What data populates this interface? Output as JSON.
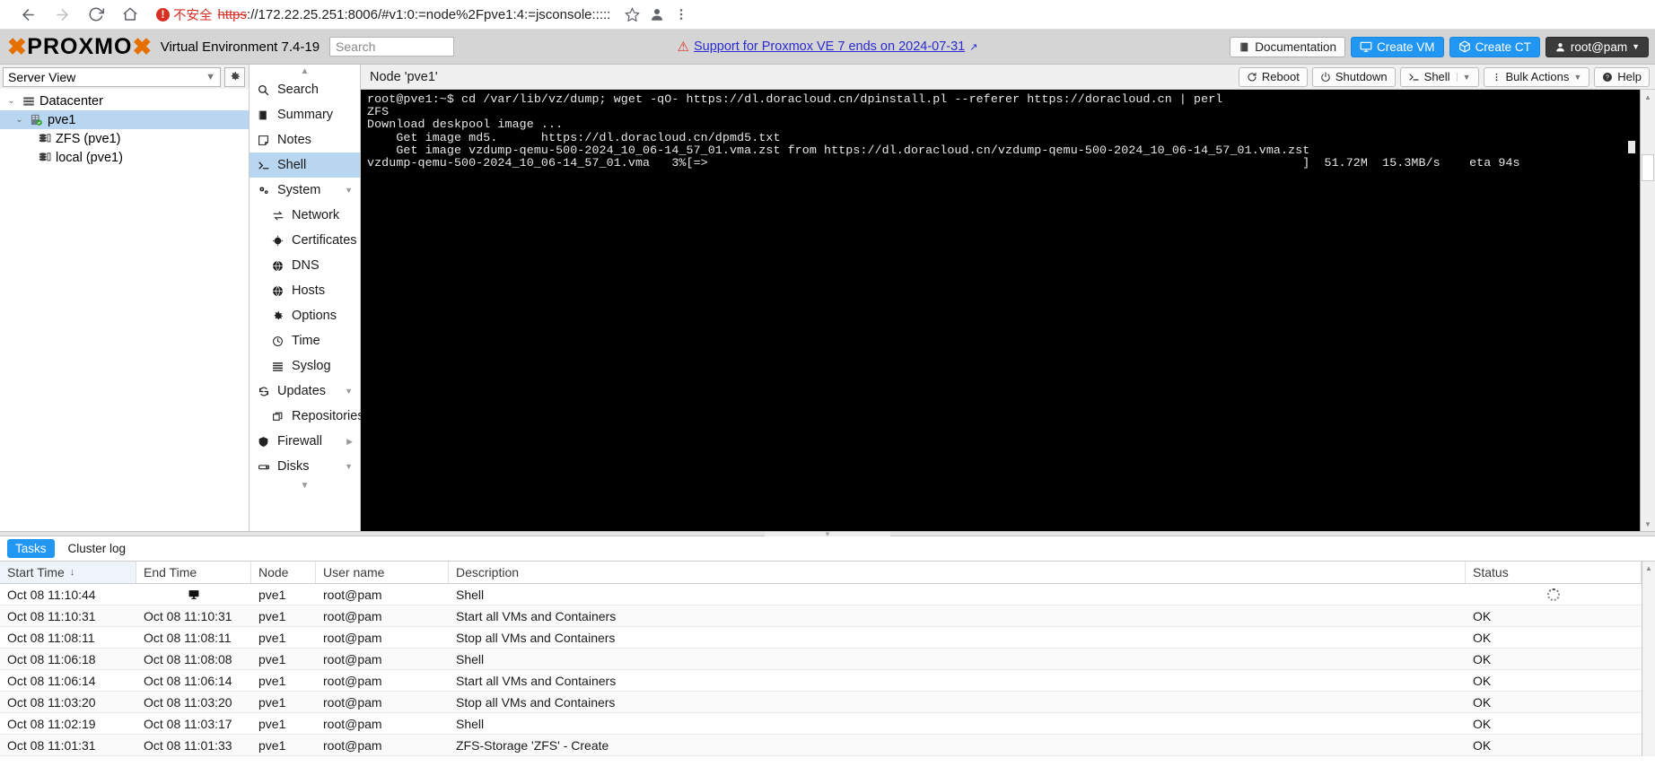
{
  "browser": {
    "back_icon": "back-arrow-icon",
    "forward_icon": "forward-arrow-icon",
    "reload_icon": "reload-icon",
    "home_icon": "home-icon",
    "security_label": "不安全",
    "url_scheme": "https",
    "url_rest": "://172.22.25.251:8006/#v1:0:=node%2Fpve1:4:=jsconsole:::::",
    "bookmark_icon": "star-icon",
    "profile_icon": "profile-icon",
    "menu_icon": "more-menu-icon"
  },
  "header": {
    "logo_word1": "PROXMO",
    "product": "Virtual Environment 7.4-19",
    "search_placeholder": "Search",
    "support_text": "Support for Proxmox VE 7 ends on 2024-07-31",
    "buttons": {
      "documentation": "Documentation",
      "create_vm": "Create VM",
      "create_ct": "Create CT",
      "user": "root@pam"
    }
  },
  "sidebar": {
    "view_label": "Server View",
    "gear_icon": "gear-icon",
    "tree": [
      {
        "label": "Datacenter",
        "icon": "datacenter-icon",
        "level": 0,
        "selected": false,
        "expander": "⌄"
      },
      {
        "label": "pve1",
        "icon": "node-icon",
        "level": 1,
        "selected": true,
        "expander": "⌄"
      },
      {
        "label": "ZFS (pve1)",
        "icon": "storage-icon",
        "level": 2,
        "selected": false,
        "expander": ""
      },
      {
        "label": "local (pve1)",
        "icon": "storage-icon",
        "level": 2,
        "selected": false,
        "expander": ""
      }
    ]
  },
  "nav": {
    "items": [
      {
        "label": "Search",
        "icon": "search-icon",
        "sub": false,
        "active": false,
        "arrow": ""
      },
      {
        "label": "Summary",
        "icon": "book-icon",
        "sub": false,
        "active": false,
        "arrow": ""
      },
      {
        "label": "Notes",
        "icon": "note-icon",
        "sub": false,
        "active": false,
        "arrow": ""
      },
      {
        "label": "Shell",
        "icon": "terminal-icon",
        "sub": false,
        "active": true,
        "arrow": ""
      },
      {
        "label": "System",
        "icon": "system-gears-icon",
        "sub": false,
        "active": false,
        "arrow": "▼"
      },
      {
        "label": "Network",
        "icon": "network-icon",
        "sub": true,
        "active": false,
        "arrow": ""
      },
      {
        "label": "Certificates",
        "icon": "certificate-icon",
        "sub": true,
        "active": false,
        "arrow": ""
      },
      {
        "label": "DNS",
        "icon": "globe-icon",
        "sub": true,
        "active": false,
        "arrow": ""
      },
      {
        "label": "Hosts",
        "icon": "globe-icon",
        "sub": true,
        "active": false,
        "arrow": ""
      },
      {
        "label": "Options",
        "icon": "gear-icon",
        "sub": true,
        "active": false,
        "arrow": ""
      },
      {
        "label": "Time",
        "icon": "clock-icon",
        "sub": true,
        "active": false,
        "arrow": ""
      },
      {
        "label": "Syslog",
        "icon": "list-icon",
        "sub": true,
        "active": false,
        "arrow": ""
      },
      {
        "label": "Updates",
        "icon": "refresh-icon",
        "sub": false,
        "active": false,
        "arrow": "▼"
      },
      {
        "label": "Repositories",
        "icon": "repository-icon",
        "sub": true,
        "active": false,
        "arrow": ""
      },
      {
        "label": "Firewall",
        "icon": "shield-icon",
        "sub": false,
        "active": false,
        "arrow": "▶"
      },
      {
        "label": "Disks",
        "icon": "disk-icon",
        "sub": false,
        "active": false,
        "arrow": "▼"
      }
    ]
  },
  "content": {
    "node_title": "Node 'pve1'",
    "toolbar": {
      "reboot": "Reboot",
      "shutdown": "Shutdown",
      "shell": "Shell",
      "bulk_actions": "Bulk Actions",
      "help": "Help"
    },
    "terminal_lines": [
      "root@pve1:~$ cd /var/lib/vz/dump; wget -qO- https://dl.doracloud.cn/dpinstall.pl --referer https://doracloud.cn | perl",
      "ZFS",
      "Download deskpool image ...",
      "    Get image md5.      https://dl.doracloud.cn/dpmd5.txt",
      "    Get image vzdump-qemu-500-2024_10_06-14_57_01.vma.zst from https://dl.doracloud.cn/vzdump-qemu-500-2024_10_06-14_57_01.vma.zst",
      "vzdump-qemu-500-2024_10_06-14_57_01.vma   3%[=>                                                                                  ]  51.72M  15.3MB/s    eta 94s"
    ]
  },
  "tasks": {
    "tabs": [
      {
        "label": "Tasks",
        "active": true
      },
      {
        "label": "Cluster log",
        "active": false
      }
    ],
    "columns": [
      "Start Time",
      "End Time",
      "Node",
      "User name",
      "Description",
      "Status"
    ],
    "sort_indicator": "↓",
    "rows": [
      {
        "start": "Oct 08 11:10:44",
        "end": "",
        "end_icon": "monitor-icon",
        "node": "pve1",
        "user": "root@pam",
        "desc": "Shell",
        "status": "",
        "status_icon": "loading-spinner-icon"
      },
      {
        "start": "Oct 08 11:10:31",
        "end": "Oct 08 11:10:31",
        "end_icon": "",
        "node": "pve1",
        "user": "root@pam",
        "desc": "Start all VMs and Containers",
        "status": "OK",
        "status_icon": ""
      },
      {
        "start": "Oct 08 11:08:11",
        "end": "Oct 08 11:08:11",
        "end_icon": "",
        "node": "pve1",
        "user": "root@pam",
        "desc": "Stop all VMs and Containers",
        "status": "OK",
        "status_icon": ""
      },
      {
        "start": "Oct 08 11:06:18",
        "end": "Oct 08 11:08:08",
        "end_icon": "",
        "node": "pve1",
        "user": "root@pam",
        "desc": "Shell",
        "status": "OK",
        "status_icon": ""
      },
      {
        "start": "Oct 08 11:06:14",
        "end": "Oct 08 11:06:14",
        "end_icon": "",
        "node": "pve1",
        "user": "root@pam",
        "desc": "Start all VMs and Containers",
        "status": "OK",
        "status_icon": ""
      },
      {
        "start": "Oct 08 11:03:20",
        "end": "Oct 08 11:03:20",
        "end_icon": "",
        "node": "pve1",
        "user": "root@pam",
        "desc": "Stop all VMs and Containers",
        "status": "OK",
        "status_icon": ""
      },
      {
        "start": "Oct 08 11:02:19",
        "end": "Oct 08 11:03:17",
        "end_icon": "",
        "node": "pve1",
        "user": "root@pam",
        "desc": "Shell",
        "status": "OK",
        "status_icon": ""
      },
      {
        "start": "Oct 08 11:01:31",
        "end": "Oct 08 11:01:33",
        "end_icon": "",
        "node": "pve1",
        "user": "root@pam",
        "desc": "ZFS-Storage 'ZFS' - Create",
        "status": "OK",
        "status_icon": ""
      }
    ]
  },
  "colors": {
    "accent_blue": "#2196f3",
    "selection_blue": "#b8d6f0",
    "brand_orange": "#e57000",
    "warning_red": "#d93025",
    "link_blue": "#2b2bd0"
  }
}
